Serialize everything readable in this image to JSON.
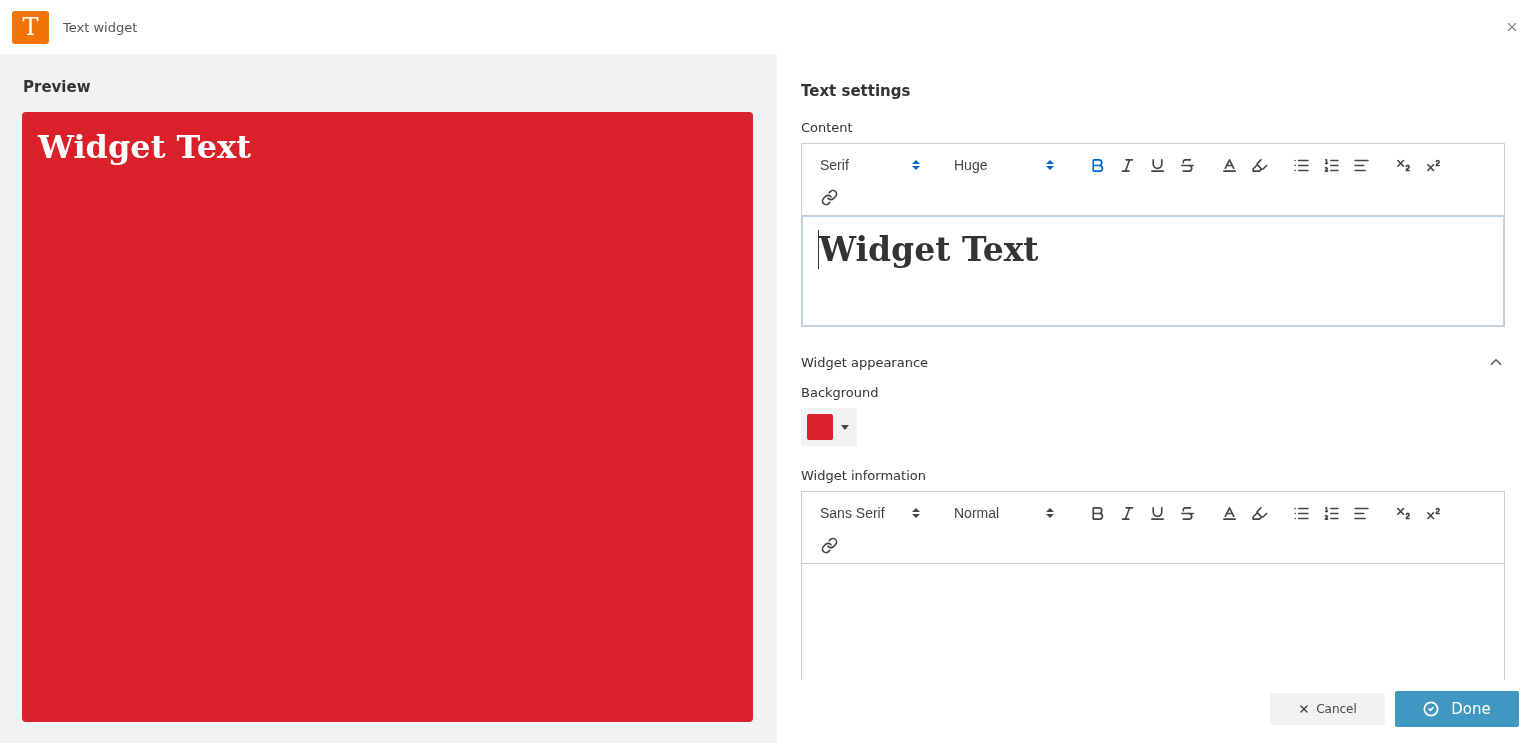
{
  "window": {
    "title": "Text widget",
    "icon_letter": "T"
  },
  "preview": {
    "heading": "Preview",
    "text": "Widget Text"
  },
  "settings": {
    "heading": "Text settings",
    "content": {
      "label": "Content",
      "value": "Widget Text",
      "toolbar": {
        "font": {
          "label": "Serif",
          "active": true
        },
        "size": {
          "label": "Huge",
          "active": true
        },
        "tools": [
          {
            "kind": "bold",
            "active": true
          },
          {
            "kind": "italic",
            "active": false
          },
          {
            "kind": "underline",
            "active": false
          },
          {
            "kind": "strike",
            "active": false
          },
          {
            "kind": "color",
            "active": false
          },
          {
            "kind": "background",
            "active": false
          },
          {
            "kind": "bullet",
            "active": false
          },
          {
            "kind": "ordered",
            "active": false
          },
          {
            "kind": "align",
            "active": false
          },
          {
            "kind": "subscript",
            "active": false
          },
          {
            "kind": "superscript",
            "active": false
          },
          {
            "kind": "link",
            "active": false
          }
        ]
      }
    },
    "appearance": {
      "heading": "Widget appearance",
      "expanded": true,
      "background_label": "Background"
    },
    "information": {
      "label": "Widget information",
      "toolbar": {
        "font": {
          "label": "Sans Serif",
          "active": false
        },
        "size": {
          "label": "Normal",
          "active": false
        },
        "tools": [
          {
            "kind": "bold",
            "active": false
          },
          {
            "kind": "italic",
            "active": false
          },
          {
            "kind": "underline",
            "active": false
          },
          {
            "kind": "strike",
            "active": false
          },
          {
            "kind": "color",
            "active": false
          },
          {
            "kind": "background",
            "active": false
          },
          {
            "kind": "bullet",
            "active": false
          },
          {
            "kind": "ordered",
            "active": false
          },
          {
            "kind": "align",
            "active": false
          },
          {
            "kind": "subscript",
            "active": false
          },
          {
            "kind": "superscript",
            "active": false
          },
          {
            "kind": "link",
            "active": false
          }
        ]
      }
    }
  },
  "footer": {
    "cancel": "Cancel",
    "done": "Done"
  }
}
